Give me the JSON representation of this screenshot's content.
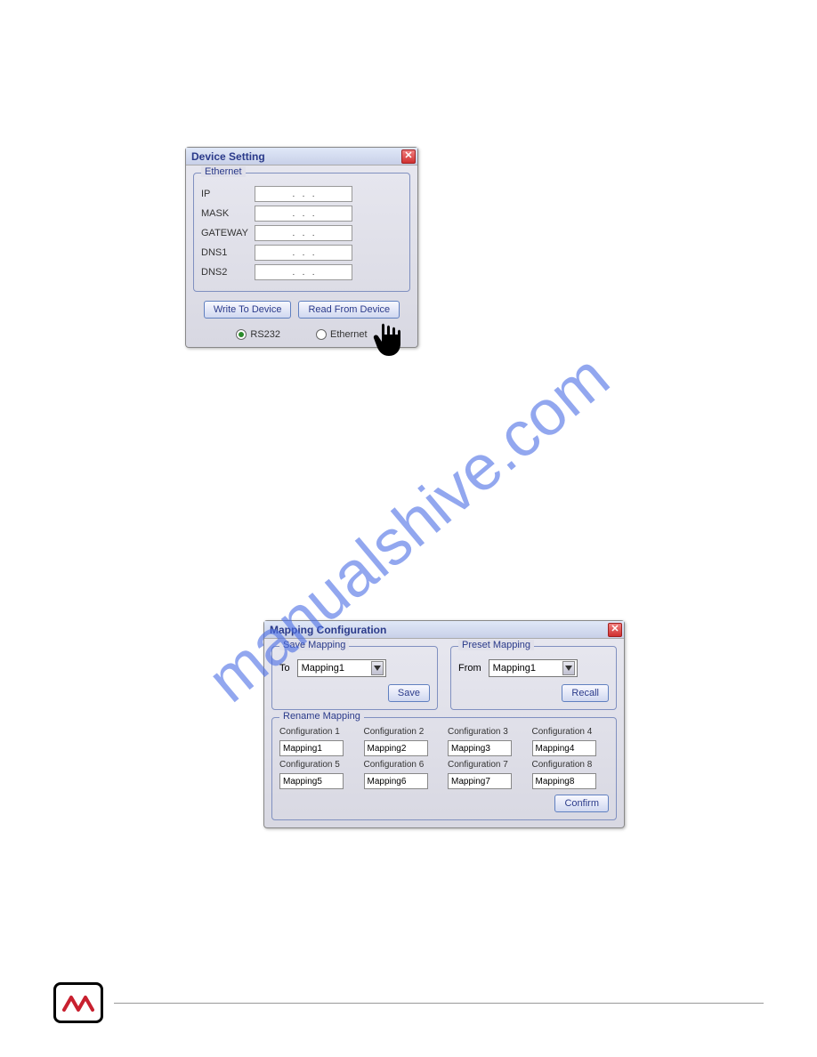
{
  "watermark": "manualshive.com",
  "dialog1": {
    "title": "Device Setting",
    "ethernet": {
      "legend": "Ethernet",
      "fields": [
        {
          "label": "IP",
          "value": ".   .   ."
        },
        {
          "label": "MASK",
          "value": ".   .   ."
        },
        {
          "label": "GATEWAY",
          "value": ".   .   ."
        },
        {
          "label": "DNS1",
          "value": ".   .   ."
        },
        {
          "label": "DNS2",
          "value": ".   .   ."
        }
      ]
    },
    "write_btn": "Write To Device",
    "read_btn": "Read From Device",
    "radio": {
      "rs232": "RS232",
      "ethernet": "Ethernet",
      "selected": "rs232"
    }
  },
  "dialog2": {
    "title": "Mapping Configuration",
    "save_mapping": {
      "legend": "Save Mapping",
      "to_label": "To",
      "to_value": "Mapping1",
      "save_btn": "Save"
    },
    "preset_mapping": {
      "legend": "Preset Mapping",
      "from_label": "From",
      "from_value": "Mapping1",
      "recall_btn": "Recall"
    },
    "rename_mapping": {
      "legend": "Rename Mapping",
      "configs": [
        {
          "label": "Configuration 1",
          "value": "Mapping1"
        },
        {
          "label": "Configuration 2",
          "value": "Mapping2"
        },
        {
          "label": "Configuration 3",
          "value": "Mapping3"
        },
        {
          "label": "Configuration 4",
          "value": "Mapping4"
        },
        {
          "label": "Configuration 5",
          "value": "Mapping5"
        },
        {
          "label": "Configuration 6",
          "value": "Mapping6"
        },
        {
          "label": "Configuration 7",
          "value": "Mapping7"
        },
        {
          "label": "Configuration 8",
          "value": "Mapping8"
        }
      ],
      "confirm_btn": "Confirm"
    }
  }
}
